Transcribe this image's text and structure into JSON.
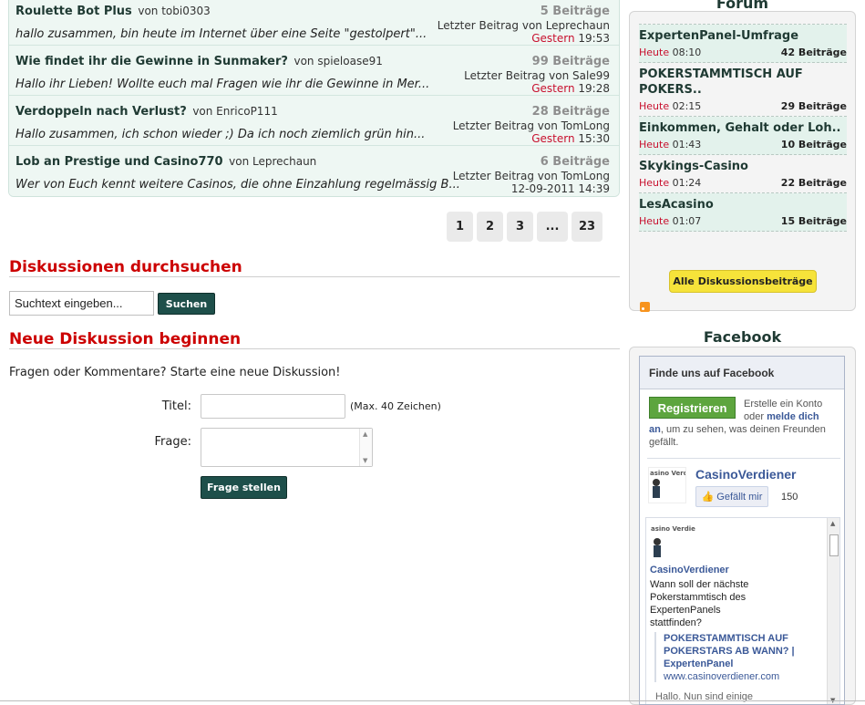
{
  "threads": [
    {
      "title": "Roulette Bot Plus",
      "by": "von tobi0303",
      "excerpt": "hallo zusammen, bin heute im Internet über eine Seite \"gestolpert\"...",
      "count": "5 Beiträge",
      "last": "Letzter Beitrag von Leprechaun",
      "day": "Gestern",
      "time": "19:53"
    },
    {
      "title": "Wie findet ihr die Gewinne in Sunmaker?",
      "by": "von spieloase91",
      "excerpt": "Hallo ihr Lieben! Wollte euch mal Fragen wie ihr die Gewinne in Mer...",
      "count": "99 Beiträge",
      "last": "Letzter Beitrag von Sale99",
      "day": "Gestern",
      "time": "19:28"
    },
    {
      "title": "Verdoppeln nach Verlust?",
      "by": "von EnricoP111",
      "excerpt": "Hallo zusammen, ich schon wieder ;) Da ich noch ziemlich grün hin...",
      "count": "28 Beiträge",
      "last": "Letzter Beitrag von TomLong",
      "day": "Gestern",
      "time": "15:30"
    },
    {
      "title": "Lob an Prestige und Casino770",
      "by": "von Leprechaun",
      "excerpt": "Wer von Euch kennt weitere Casinos, die ohne Einzahlung regelmässig B...",
      "count": "6 Beiträge",
      "last": "Letzter Beitrag von TomLong",
      "day": "",
      "time": "12-09-2011 14:39"
    }
  ],
  "pagination": [
    "1",
    "2",
    "3",
    "...",
    "23"
  ],
  "search": {
    "heading": "Diskussionen durchsuchen",
    "value": "Suchtext eingeben...",
    "button": "Suchen"
  },
  "new_discussion": {
    "heading": "Neue Diskussion beginnen",
    "intro": "Fragen oder Kommentare? Starte eine neue Diskussion!",
    "title_label": "Titel:",
    "title_hint": "(Max. 40 Zeichen)",
    "question_label": "Frage:",
    "submit": "Frage stellen"
  },
  "forum_sidebar": {
    "title": "Forum",
    "items": [
      {
        "name": "ExpertenPanel-Umfrage",
        "day": "Heute",
        "time": "08:10",
        "count": "42 Beiträge"
      },
      {
        "name": "POKERSTAMMTISCH AUF POKERS..",
        "day": "Heute",
        "time": "02:15",
        "count": "29 Beiträge"
      },
      {
        "name": "Einkommen, Gehalt oder Loh..",
        "day": "Heute",
        "time": "01:43",
        "count": "10 Beiträge"
      },
      {
        "name": "Skykings-Casino",
        "day": "Heute",
        "time": "01:24",
        "count": "22 Beiträge"
      },
      {
        "name": "LesAcasino",
        "day": "Heute",
        "time": "01:07",
        "count": "15 Beiträge"
      }
    ],
    "all_button": "Alle Diskussionsbeiträge"
  },
  "facebook": {
    "title": "Facebook",
    "header": "Finde uns auf Facebook",
    "register": "Registrieren",
    "register_text_1": "Erstelle ein Konto",
    "register_text_2": "oder",
    "login_link": "melde dich",
    "login_link_2": "an",
    "register_text_3": ", um zu sehen, was deinen Freunden gefällt.",
    "page_name": "CasinoVerdiener",
    "like": "Gefällt mir",
    "like_count": "150",
    "logo_text": "asino Verdiener",
    "post_author": "CasinoVerdiener",
    "post_text": "Wann soll der nächste Pokerstammtisch des ExpertenPanels stattfinden?",
    "attach_title": "POKERSTAMMTISCH AUF POKERSTARS AB WANN? | ExpertenPanel",
    "attach_url": "www.casinoverdiener.com",
    "post_more": "Hallo. Nun sind einige"
  }
}
